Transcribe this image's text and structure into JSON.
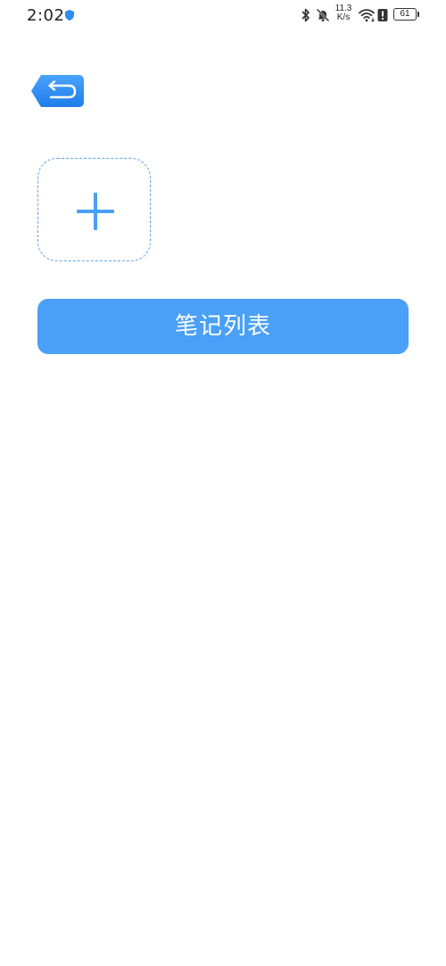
{
  "status_bar": {
    "time": "2:02",
    "net_speed_value": "11.3",
    "net_speed_unit": "K/s",
    "battery": "61",
    "icons": [
      "shield-icon",
      "bluetooth-icon",
      "bell-off-icon",
      "wifi-icon",
      "alert-icon",
      "battery-icon"
    ]
  },
  "toolbar": {
    "back_icon": "back-arrow-icon"
  },
  "main": {
    "add_icon": "plus-icon",
    "note_list_label": "笔记列表"
  },
  "colors": {
    "primary": "#4aa0f7",
    "back_button": "#2d86f0",
    "dashed_border": "#5da4ee",
    "background": "#ffffff"
  }
}
